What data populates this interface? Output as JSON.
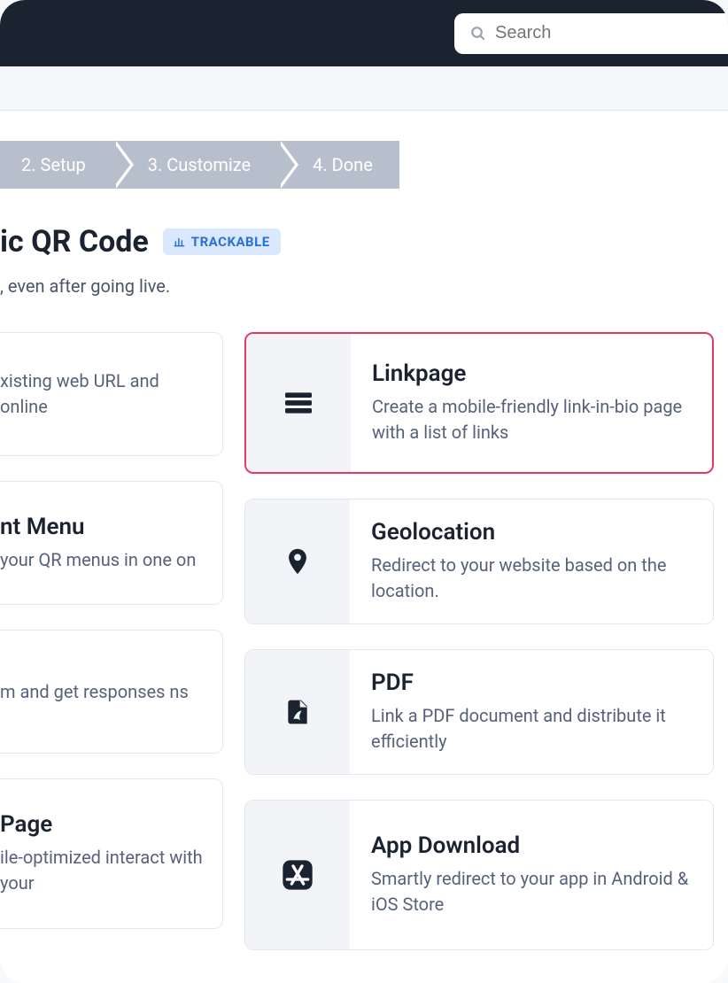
{
  "search": {
    "placeholder": "Search"
  },
  "steps": [
    {
      "label": "2. Setup"
    },
    {
      "label": "3. Customize"
    },
    {
      "label": "4. Done"
    }
  ],
  "page": {
    "title_fragment": "ic QR Code",
    "badge": "TRACKABLE",
    "subtitle_fragment": ", even after going live."
  },
  "left_cards": [
    {
      "title": "",
      "desc": "xisting web URL and online"
    },
    {
      "title": "nt Menu",
      "desc": "your QR menus in one on"
    },
    {
      "title": "",
      "desc": "m and get responses ns"
    },
    {
      "title": "Page",
      "desc": "ile-optimized interact with your"
    }
  ],
  "right_cards": [
    {
      "icon": "menu-icon",
      "title": "Linkpage",
      "desc": "Create a mobile-friendly link-in-bio page with a list of links",
      "highlight": true
    },
    {
      "icon": "pin-icon",
      "title": "Geolocation",
      "desc": "Redirect to your website based on the location."
    },
    {
      "icon": "pdf-icon",
      "title": "PDF",
      "desc": "Link a PDF document and distribute it efficiently"
    },
    {
      "icon": "appstore-icon",
      "title": "App Download",
      "desc": "Smartly redirect to your app in Android & iOS Store"
    }
  ]
}
